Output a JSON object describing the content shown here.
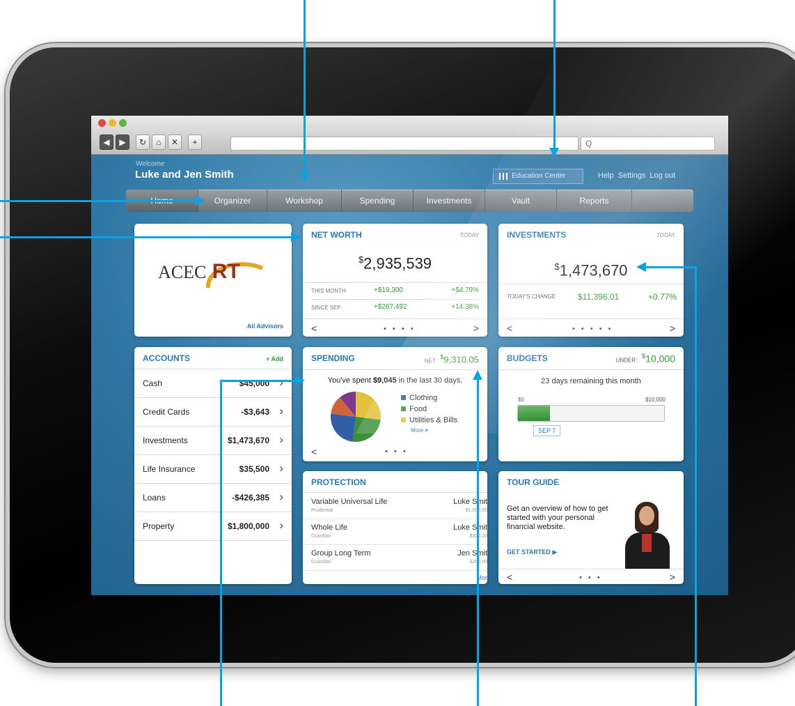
{
  "browser": {
    "search_placeholder": "Q"
  },
  "header": {
    "welcome": "Welcome",
    "user": "Luke and Jen Smith",
    "education_center": "Education Center",
    "links": [
      "Help",
      "Settings",
      "Log out"
    ]
  },
  "tabs": [
    "Home",
    "Organizer",
    "Workshop",
    "Spending",
    "Investments",
    "Vault",
    "Reports"
  ],
  "advisor": {
    "logo_text": "ACEC",
    "logo_mark": "RT",
    "link": "All Advisors"
  },
  "net_worth": {
    "title": "NET WORTH",
    "when": "TODAY",
    "value": "2,935,539",
    "currency": "$",
    "rows": [
      {
        "label": "THIS MONTH",
        "amount": "+$19,300",
        "pct": "+$4.79%"
      },
      {
        "label": "SINCE SEP",
        "amount": "+$267,492",
        "pct": "+14.38%"
      }
    ]
  },
  "investments": {
    "title": "INVESTMENTS",
    "when": "TODAY",
    "currency": "$",
    "value": "1,473,670",
    "change_label": "TODAY'S CHANGE",
    "change_amount": "$11,396.01",
    "change_pct": "+0.77%"
  },
  "accounts": {
    "title": "ACCOUNTS",
    "add": "+ Add",
    "items": [
      {
        "name": "Cash",
        "value": "$45,000"
      },
      {
        "name": "Credit Cards",
        "value": "-$3,643"
      },
      {
        "name": "Investments",
        "value": "$1,473,670"
      },
      {
        "name": "Life Insurance",
        "value": "$35,500"
      },
      {
        "name": "Loans",
        "value": "-$426,385"
      },
      {
        "name": "Property",
        "value": "$1,800,000"
      }
    ]
  },
  "spending": {
    "title": "SPENDING",
    "net_label": "NET",
    "net_currency": "$",
    "net_value": "9,310.05",
    "summary_pre": "You've spent ",
    "summary_amount": "$9,045",
    "summary_post": " in the last 30 days.",
    "legend": [
      {
        "name": "Clothing",
        "color": "#2f5fa6"
      },
      {
        "name": "Food",
        "color": "#3c8f3c"
      },
      {
        "name": "Utilities & Bills",
        "color": "#e2c23a"
      }
    ],
    "more": "More ▾",
    "pie_colors": [
      "#2f5fa6",
      "#3c8f3c",
      "#e2c23a",
      "#7b3c8c",
      "#d3623a"
    ]
  },
  "budgets": {
    "title": "BUDGETS",
    "under_label": "UNDER:",
    "under_currency": "$",
    "under_value": "10,000",
    "remaining": "23 days remaining this month",
    "min": "$0",
    "max": "$10,000",
    "marker": "SEP 7",
    "progress": 0.22
  },
  "protection": {
    "title": "PROTECTION",
    "items": [
      {
        "name": "Variable Universal Life",
        "provider": "Prudential",
        "owner": "Luke Smit",
        "amount": "$1,000,00"
      },
      {
        "name": "Whole Life",
        "provider": "Guardian",
        "owner": "Luke Smit",
        "amount": "$300,00"
      },
      {
        "name": "Group Long Term",
        "provider": "Guardian",
        "owner": "Jen Smit",
        "amount": "$200,00"
      }
    ],
    "more": "Mor"
  },
  "tour": {
    "title": "TOUR GUIDE",
    "text": "Get an overview of how to get started with your personal financial website.",
    "cta": "GET STARTED ▶"
  },
  "nav": {
    "prev": "<",
    "next": ">",
    "dots4": "• • • •",
    "dots5": "• • • • •",
    "dots3": "• • •"
  },
  "colors": {
    "annotation": "#0aa3e2",
    "accent": "#2a79b3",
    "positive": "#2e9e2e"
  }
}
